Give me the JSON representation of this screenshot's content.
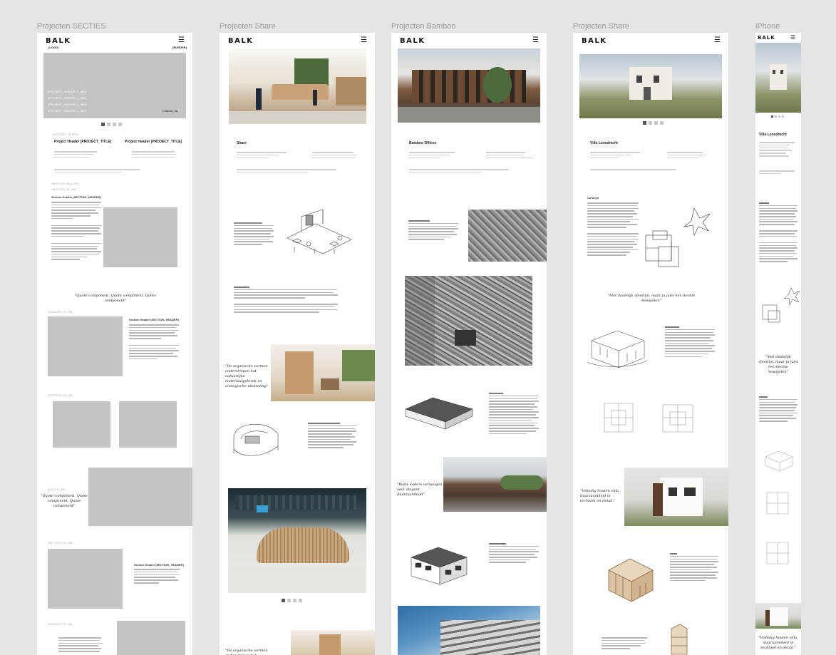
{
  "frames": [
    {
      "label": "Projecten SECTIES",
      "logo": "BALK",
      "logo_placeholder": "(LOGO)",
      "burger_placeholder": "(BURGER)",
      "header_images": [
        "(PROJECT_HEADER_1_IMG)",
        "(PROJECT_HEADER_2_IMG)",
        "(PROJECT_HEADER_3_IMG)",
        "(PROJECT_HEADER_4_IMG)"
      ],
      "image_tag": "(IMAGE_01)",
      "project_intro": "(PROJECT_INTRO)",
      "project_header_left": "Project Header (PROJECT_TITLE)",
      "project_header_right": "Project Header (PROJECT_TITLE)",
      "section_headings": [
        "(SECTION_BLOCKS)",
        "(SECTION_01_HB)",
        "(SECTION_02_HB)",
        "(SECTION_03_HB)",
        "(QUOTE_HB)",
        "(SECTION_04_HB)",
        "(SECTION_05_HB)"
      ],
      "section_header_label": "Section Header (SECTION_HEADER)",
      "quote_1": "\"Quote component. Quote component. Quote component\"",
      "quote_2": "\"Quote component. Quote component. Quote component\""
    },
    {
      "label": "Projecten Share",
      "logo": "BALK",
      "title": "Share",
      "quote": "\"De organische vormen onderstrepen het natuurlijke materiaalgebruik en ecologische uitstraling\""
    },
    {
      "label": "Projecten Bamboo",
      "logo": "BALK",
      "title": "Bamboo Offices",
      "quote": "\"Beste kaders vervangen voor elegant duurzaamheid\""
    },
    {
      "label": "Projecten Share",
      "logo": "BALK",
      "title": "Villa Loosdrecht",
      "section_label": "Concept",
      "quote_1": "\"Met duidelijk sfeerlijn, maar ja juist het slechte bewijsden\"",
      "quote_2": "\"Volledig houten villa, duurzaamheid in techniek en detail.\""
    },
    {
      "label": "iPhone",
      "logo": "BALK",
      "title": "Villa Loosdrecht",
      "quote_1": "\"Met duidelijk sfeerlijn, maar ja juist het slechte bewijsden\"",
      "quote_2": "\"Volledig houten villa, duurzaamheid in techniek en detail.\""
    }
  ],
  "burger_icon": "☰",
  "colors": {
    "canvas": "#e5e5e5",
    "placeholder": "#c4c4c4",
    "dot_active": "#555555",
    "dot_inactive": "#c8c8c8"
  }
}
